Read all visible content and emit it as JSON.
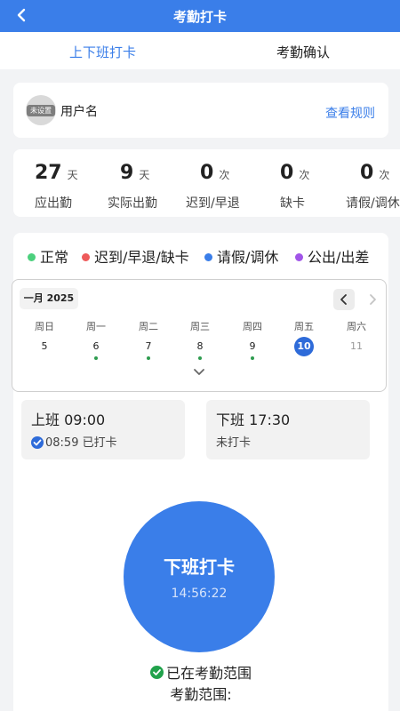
{
  "header": {
    "title": "考勤打卡"
  },
  "tabs": [
    {
      "label": "上下班打卡"
    },
    {
      "label": "考勤确认"
    }
  ],
  "user": {
    "avatar_badge": "未设置",
    "name": "用户名",
    "rules_link": "查看规则"
  },
  "stats": [
    {
      "value": "27",
      "unit": "天",
      "label": "应出勤"
    },
    {
      "value": "9",
      "unit": "天",
      "label": "实际出勤"
    },
    {
      "value": "0",
      "unit": "次",
      "label": "迟到/早退"
    },
    {
      "value": "0",
      "unit": "次",
      "label": "缺卡"
    },
    {
      "value": "0",
      "unit": "次",
      "label": "请假/调休"
    }
  ],
  "legend": [
    {
      "label": "正常",
      "color": "#4cd07d"
    },
    {
      "label": "迟到/早退/缺卡",
      "color": "#ee5a5a"
    },
    {
      "label": "请假/调休",
      "color": "#3a7ee9"
    },
    {
      "label": "公出/出差",
      "color": "#a155e8"
    }
  ],
  "calendar": {
    "month": "一月 2025",
    "weekdays": [
      "周日",
      "周一",
      "周二",
      "周三",
      "周四",
      "周五",
      "周六"
    ],
    "dates": [
      "5",
      "6",
      "7",
      "8",
      "9",
      "10",
      "11"
    ],
    "marked_color": "#2e9c4f",
    "today_color": "#2e6bd9"
  },
  "punch": {
    "on": {
      "title": "上班 09:00",
      "time": "08:59",
      "status": "已打卡"
    },
    "off": {
      "title": "下班 17:30",
      "status": "未打卡"
    }
  },
  "main_button": {
    "label": "下班打卡",
    "time": "14:56:22",
    "color": "#3a7ee9"
  },
  "range": {
    "status": "已在考勤范围",
    "label": "考勤范围:"
  }
}
